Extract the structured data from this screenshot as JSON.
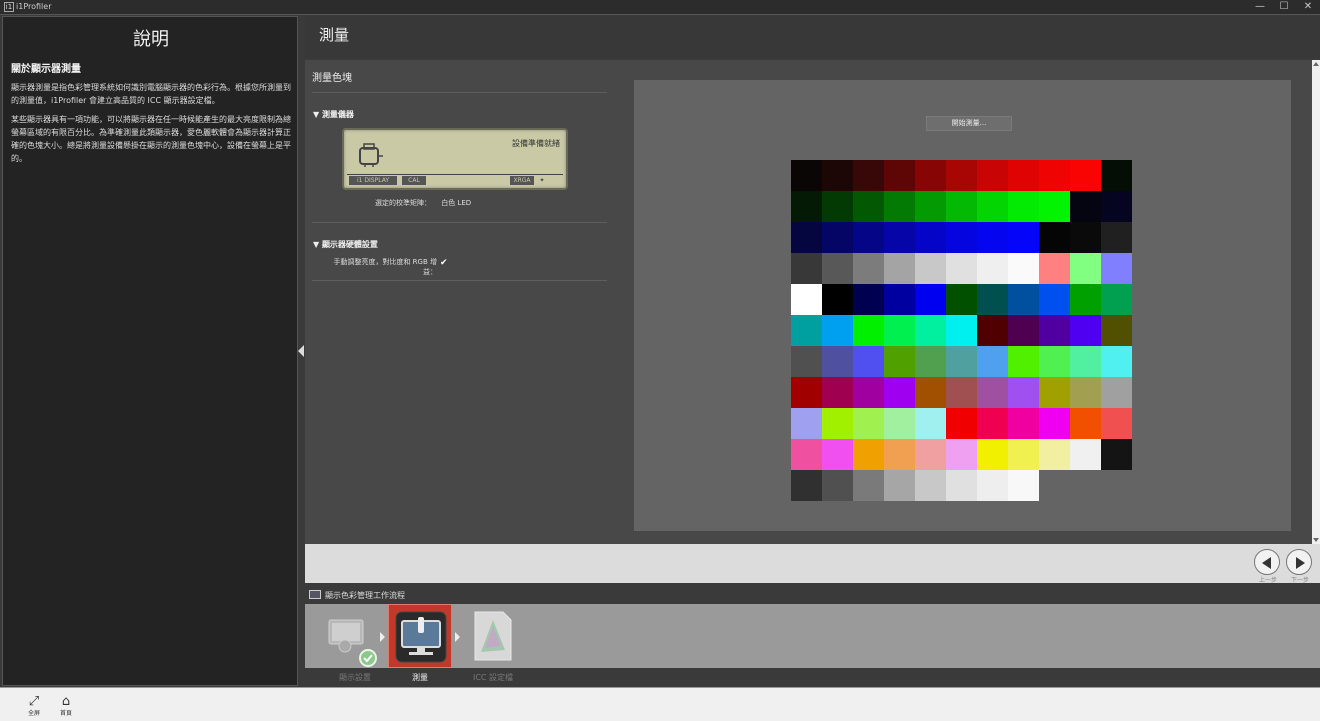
{
  "window": {
    "title": "i1Profiler",
    "app_icon": "i1",
    "controls": [
      "—",
      "☐",
      "✕"
    ]
  },
  "help": {
    "title": "說明",
    "subtitle": "關於顯示器測量",
    "para1": "顯示器測量是指色彩管理系統如何識別電腦顯示器的色彩行為。根據您所測量到的測量值，i1Profiler 會建立高品質的 ICC 顯示器設定檔。",
    "para2": "某些顯示器具有一項功能，可以將顯示器在任一時候能產生的最大亮度限制為總螢幕區域的有限百分比。為準確測量此類顯示器，愛色麗軟體會為顯示器計算正確的色塊大小。總是將測量設備懸掛在顯示的測量色塊中心，設備在螢幕上是平的。"
  },
  "header": {
    "title": "測量"
  },
  "measure": {
    "section_title": "測量色塊",
    "instrument_heading": "▼ 測量儀器",
    "device_status": "設備準備就緒",
    "lcd_segments": [
      "i1 DISPLAY",
      "CAL",
      "XRGA",
      "✦"
    ],
    "calibration_label": "選定的校準矩陣：",
    "calibration_value": "白色 LED",
    "hardware_heading": "▼ 顯示器硬體設置",
    "manual_adjust_label": "手動調整亮度，對比度和 RGB 增益：",
    "manual_adjust_checked": "✔",
    "start_button": "開始測量..."
  },
  "patches": [
    [
      "#0b0606",
      "#1c0606",
      "#380707",
      "#5e0505",
      "#870505",
      "#a80505",
      "#c80404",
      "#e00303",
      "#f00303",
      "#fa0303",
      "#050e05"
    ],
    [
      "#051a05",
      "#033a03",
      "#035803",
      "#037a03",
      "#039a03",
      "#03b903",
      "#03d503",
      "#03ea03",
      "#03f403",
      "#050512",
      "#050520"
    ],
    [
      "#050540",
      "#050565",
      "#050588",
      "#0505a8",
      "#0505c8",
      "#0505e0",
      "#0505f0",
      "#0505fa",
      "#050505",
      "#0a0a0a",
      "#202020"
    ],
    [
      "#383838",
      "#585858",
      "#7c7c7c",
      "#a4a4a4",
      "#c8c8c8",
      "#e0e0e0",
      "#efefef",
      "#fafafa",
      "#ff8080",
      "#80ff80",
      "#8080ff"
    ],
    [
      "#ffffff",
      "#000000",
      "#000050",
      "#0000a0",
      "#0000f0",
      "#005000",
      "#005050",
      "#0050a0",
      "#0050f0",
      "#00a000",
      "#00a050"
    ],
    [
      "#00a0a0",
      "#00a0f0",
      "#00f000",
      "#00f050",
      "#00f0a0",
      "#00f0f0",
      "#500000",
      "#500050",
      "#5000a0",
      "#5000f0",
      "#505000"
    ],
    [
      "#505050",
      "#5050a0",
      "#5050f0",
      "#50a000",
      "#50a050",
      "#50a0a0",
      "#50a0f0",
      "#50f000",
      "#50f050",
      "#50f0a0",
      "#50f0f0"
    ],
    [
      "#a00000",
      "#a00050",
      "#a000a0",
      "#a000f0",
      "#a05000",
      "#a05050",
      "#a050a0",
      "#a050f0",
      "#a0a000",
      "#a0a050",
      "#a0a0a0"
    ],
    [
      "#a0a0f0",
      "#a0f000",
      "#a0f050",
      "#a0f0a0",
      "#a0f0f0",
      "#f00000",
      "#f00050",
      "#f000a0",
      "#f000f0",
      "#f05000",
      "#f05050"
    ],
    [
      "#f050a0",
      "#f050f0",
      "#f0a000",
      "#f0a050",
      "#f0a0a0",
      "#f0a0f0",
      "#f0f000",
      "#f0f050",
      "#f0f0a0",
      "#f0f0f0",
      "#141414"
    ],
    [
      "#303030",
      "#505050",
      "#7a7a7a",
      "#a6a6a6",
      "#c8c8c8",
      "#e0e0e0",
      "#eeeeee",
      "#f8f8f8"
    ]
  ],
  "nav": {
    "back_label": "上一步",
    "next_label": "下一步"
  },
  "workflow": {
    "title": "顯示色彩管理工作流程",
    "steps": [
      {
        "label": "顯示設置"
      },
      {
        "label": "測量"
      },
      {
        "label": "ICC 設定檔"
      }
    ]
  },
  "bottom": {
    "fullscreen_label": "全屏",
    "home_label": "首頁"
  }
}
